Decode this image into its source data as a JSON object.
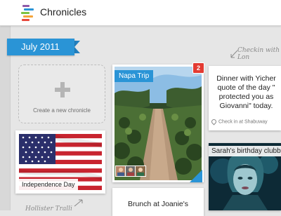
{
  "app": {
    "title": "Chronicles",
    "logo_colors": [
      "#e8493d",
      "#f4a43a",
      "#2a94d6",
      "#7dc242",
      "#8e5aa8"
    ]
  },
  "timeline": {
    "month_label": "July 2011"
  },
  "annotations": {
    "checkin_note": "Checkin with Lon",
    "bottom_note": "Hollister Tralli"
  },
  "create_card": {
    "label": "Create a new chronicle"
  },
  "cards": {
    "independence": {
      "label": "Independence Day"
    },
    "napa": {
      "title": "Napa Trip",
      "badge": "2"
    },
    "dinner": {
      "lines": [
        "Dinner with Yicher",
        "quote of the day \"",
        "protected you as",
        "Giovanni\" today."
      ],
      "checkin": "Check in at Shabuway"
    },
    "sarah": {
      "title": "Sarah's birthday clubbin"
    },
    "brunch": {
      "text": "Brunch at Joanie's"
    }
  },
  "colors": {
    "accent": "#2a94d6",
    "badge": "#e33b32"
  }
}
